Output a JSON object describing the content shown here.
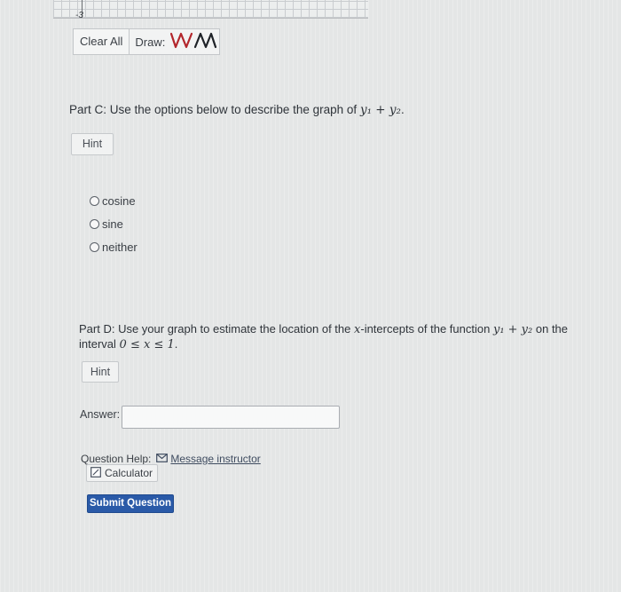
{
  "graph": {
    "tick_label": "-3"
  },
  "toolbar": {
    "clear_all_label": "Clear All",
    "draw_label": "Draw:",
    "draw_icon": "sine-wave-icon"
  },
  "part_c": {
    "text_before": "Part C: Use the options below to describe the graph of",
    "math": "y₁ + y₂",
    "text_after": ".",
    "hint_label": "Hint",
    "options": [
      {
        "label": "cosine"
      },
      {
        "label": "sine"
      },
      {
        "label": "neither"
      }
    ]
  },
  "part_d": {
    "text_before": "Part D: Use your graph to estimate the location of the",
    "math_var": "x",
    "text_mid": "-intercepts of the function",
    "math_fn": "y₁ + y₂",
    "text_after": "on the interval",
    "math_interval": "0 ≤ x ≤ 1",
    "text_end": ".",
    "hint_label": "Hint",
    "answer_label": "Answer:",
    "answer_value": ""
  },
  "help": {
    "label": "Question Help:",
    "message_label": "Message instructor",
    "calculator_label": "Calculator"
  },
  "submit": {
    "label": "Submit Question"
  },
  "colors": {
    "submit_bg": "#2a5aa8",
    "draw_icon_color": "#b3262c"
  }
}
